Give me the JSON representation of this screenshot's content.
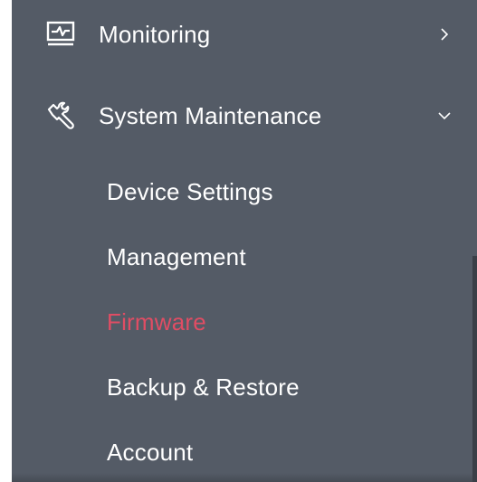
{
  "colors": {
    "sidebar_bg": "#545b66",
    "text": "#ffffff",
    "active": "#e04d64"
  },
  "menu": {
    "monitoring": {
      "label": "Monitoring",
      "icon": "monitor-pulse-icon",
      "expanded": false
    },
    "system_maintenance": {
      "label": "System Maintenance",
      "icon": "wrench-icon",
      "expanded": true,
      "items": [
        {
          "label": "Device Settings",
          "active": false
        },
        {
          "label": "Management",
          "active": false
        },
        {
          "label": "Firmware",
          "active": true
        },
        {
          "label": "Backup & Restore",
          "active": false
        },
        {
          "label": "Account",
          "active": false
        }
      ]
    }
  }
}
